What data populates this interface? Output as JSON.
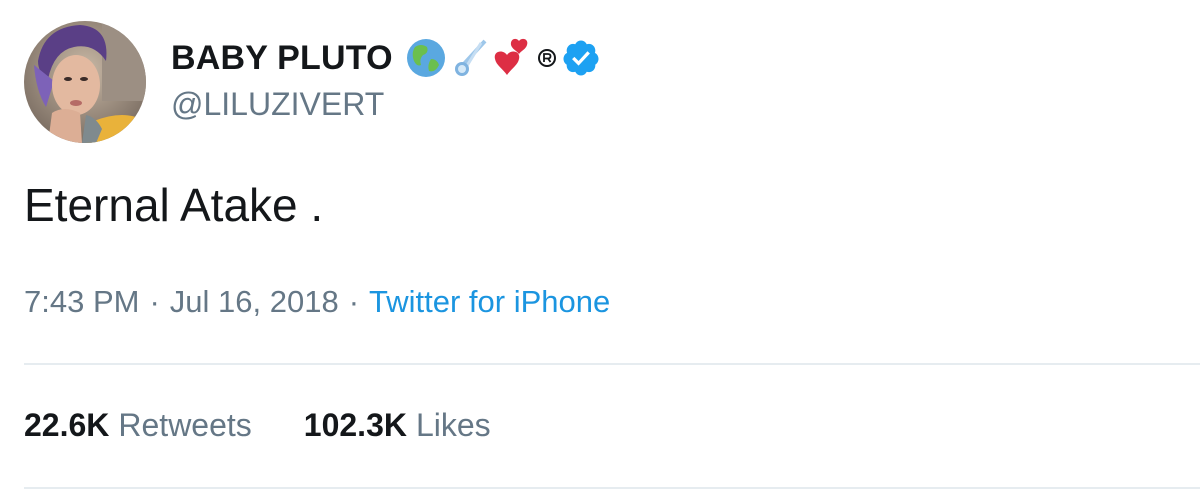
{
  "user": {
    "display_name": "BABY PLUTO",
    "handle": "@LILUZIVERT",
    "name_emojis": [
      "globe-americas-icon",
      "comet-icon",
      "heart-exclamation-icon",
      "registered-icon"
    ],
    "verified": true,
    "avatar": "profile-photo"
  },
  "tweet": {
    "text": "Eternal Atake .",
    "time": "7:43 PM",
    "separator": "·",
    "date": "Jul 16, 2018",
    "source": "Twitter for iPhone"
  },
  "stats": {
    "retweets_count": "22.6K",
    "retweets_label": "Retweets",
    "likes_count": "102.3K",
    "likes_label": "Likes"
  },
  "colors": {
    "text": "#14171a",
    "secondary": "#657786",
    "link": "#1b95e0",
    "verified": "#1da1f2",
    "divider": "#e6ecf0"
  }
}
